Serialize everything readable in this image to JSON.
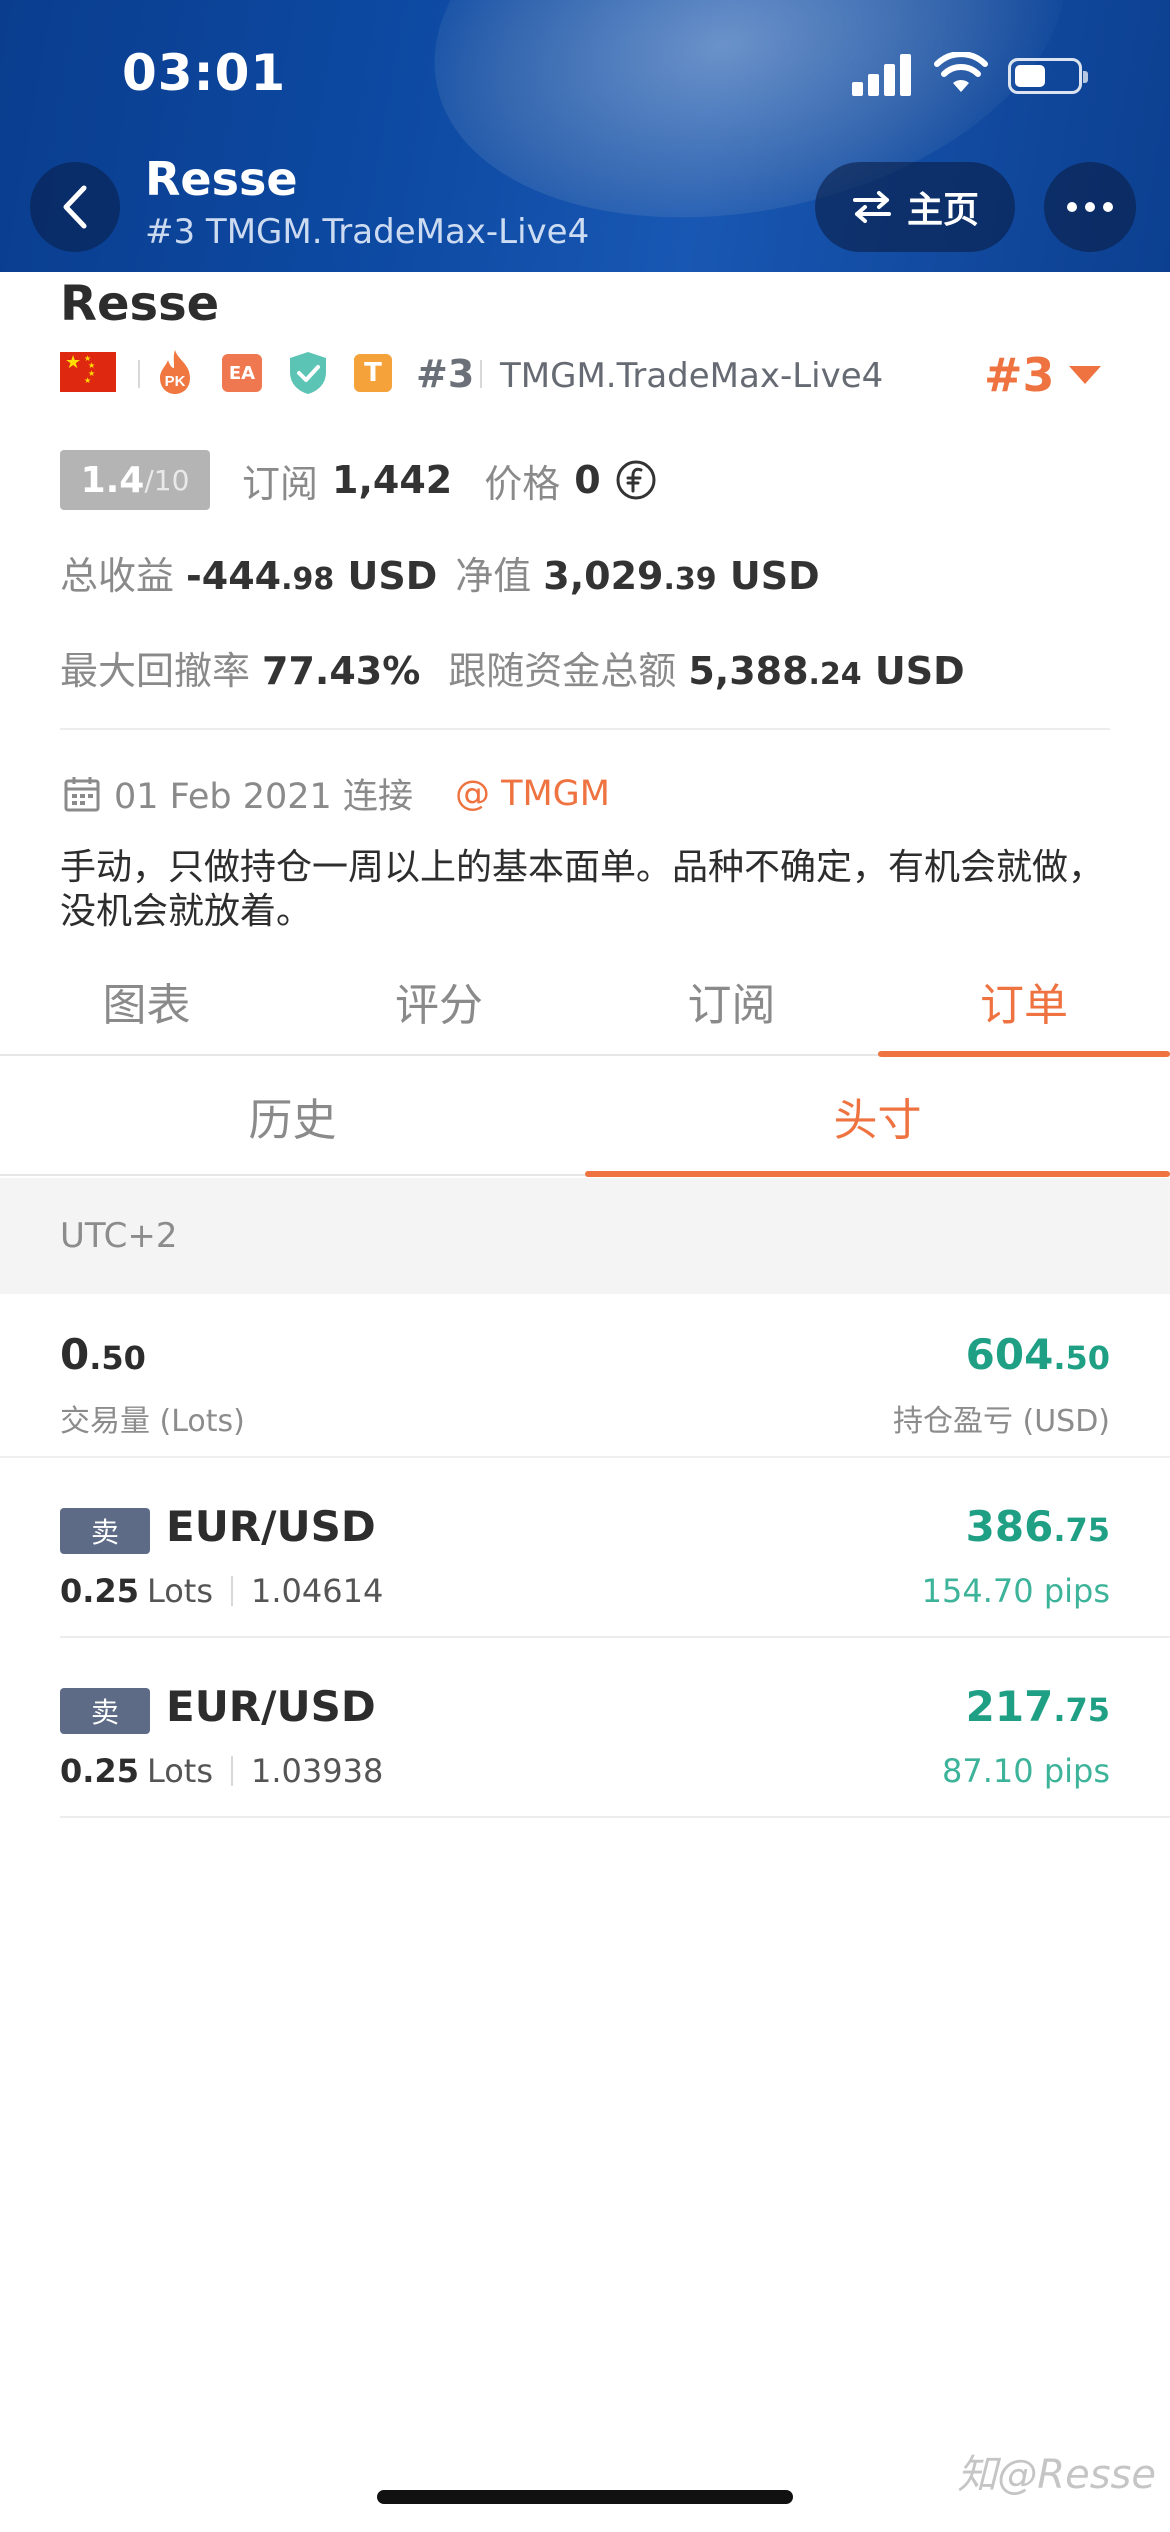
{
  "status_bar": {
    "time": "03:01"
  },
  "header": {
    "title": "Resse",
    "subtitle": "#3 TMGM.TradeMax-Live4",
    "home_label": "主页"
  },
  "profile": {
    "name": "Resse",
    "rank_small": "#3",
    "broker": "TMGM.TradeMax-Live4",
    "rank_big": "#3",
    "ea_label": "EA",
    "t_label": "T",
    "pk_label": "PK",
    "score": "1.4",
    "score_max": "/10",
    "subscribe_label": "订阅",
    "subscribe_count": "1,442",
    "price_label": "价格",
    "price_value": "0",
    "total_profit_label": "总收益",
    "total_profit_int": "-444",
    "total_profit_dec": ".98",
    "total_profit_unit": "USD",
    "equity_label": "净值",
    "equity_int": "3,029",
    "equity_dec": ".39",
    "equity_unit": "USD",
    "drawdown_label": "最大回撤率",
    "drawdown_value": "77.43%",
    "follow_label": "跟随资金总额",
    "follow_int": "5,388",
    "follow_dec": ".24",
    "follow_unit": "USD",
    "since_text": "01 Feb 2021 连接",
    "broker_link": "@ TMGM",
    "description": "手动，只做持仓一周以上的基本面单。品种不确定，有机会就做，没机会就放着。"
  },
  "tabs": [
    "图表",
    "评分",
    "订阅",
    "订单"
  ],
  "active_tab": 3,
  "subtabs": [
    "历史",
    "头寸"
  ],
  "active_subtab": 1,
  "timezone": "UTC+2",
  "summary": {
    "lots_int": "0",
    "lots_dec": ".50",
    "lots_label": "交易量 (Lots)",
    "pl_int": "604",
    "pl_dec": ".50",
    "pl_label": "持仓盈亏 (USD)"
  },
  "orders": [
    {
      "side": "卖",
      "symbol": "EUR/USD",
      "lots": "0.25",
      "lots_unit": "Lots",
      "price": "1.04614",
      "pl_int": "386",
      "pl_dec": ".75",
      "pips": "154.70 pips"
    },
    {
      "side": "卖",
      "symbol": "EUR/USD",
      "lots": "0.25",
      "lots_unit": "Lots",
      "price": "1.03938",
      "pl_int": "217",
      "pl_dec": ".75",
      "pips": "87.10 pips"
    }
  ],
  "watermark": "知@Resse",
  "colors": {
    "accent": "#ee7340",
    "profit": "#1fa085",
    "header": "#0d4aa3",
    "sell_badge": "#5d6b86"
  }
}
